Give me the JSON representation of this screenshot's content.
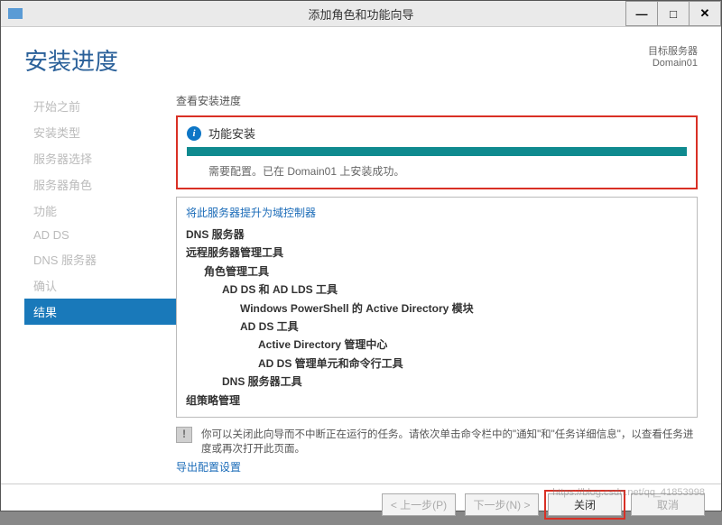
{
  "window": {
    "title": "添加角色和功能向导"
  },
  "header": {
    "page_title": "安装进度",
    "target_label": "目标服务器",
    "target_value": "Domain01"
  },
  "sidebar": {
    "items": [
      {
        "label": "开始之前"
      },
      {
        "label": "安装类型"
      },
      {
        "label": "服务器选择"
      },
      {
        "label": "服务器角色"
      },
      {
        "label": "功能"
      },
      {
        "label": "AD DS"
      },
      {
        "label": "DNS 服务器"
      },
      {
        "label": "确认"
      },
      {
        "label": "结果"
      }
    ]
  },
  "main": {
    "view_label": "查看安装进度",
    "status_title": "功能安装",
    "status_message": "需要配置。已在 Domain01 上安装成功。",
    "promote_link": "将此服务器提升为域控制器",
    "tree": [
      {
        "level": 0,
        "label": "DNS 服务器"
      },
      {
        "level": 0,
        "label": "远程服务器管理工具"
      },
      {
        "level": 1,
        "label": "角色管理工具"
      },
      {
        "level": 2,
        "label": "AD DS 和 AD LDS 工具"
      },
      {
        "level": 3,
        "label": "Windows PowerShell 的 Active Directory 模块"
      },
      {
        "level": 3,
        "label": "AD DS 工具"
      },
      {
        "level": 4,
        "label": "Active Directory 管理中心"
      },
      {
        "level": 4,
        "label": "AD DS 管理单元和命令行工具"
      },
      {
        "level": 2,
        "label": "DNS 服务器工具"
      },
      {
        "level": 0,
        "label": "组策略管理"
      }
    ],
    "note_text": "你可以关闭此向导而不中断正在运行的任务。请依次单击命令栏中的\"通知\"和\"任务详细信息\"，以查看任务进度或再次打开此页面。",
    "export_link": "导出配置设置"
  },
  "footer": {
    "previous": "< 上一步(P)",
    "next": "下一步(N) >",
    "close": "关闭",
    "cancel": "取消"
  },
  "watermark": "https://blog.csdn.net/qq_41853998"
}
